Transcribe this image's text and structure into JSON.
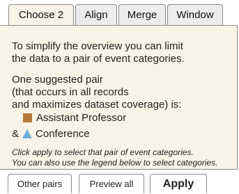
{
  "tabs": [
    {
      "label": "Choose 2",
      "active": true
    },
    {
      "label": "Align",
      "active": false
    },
    {
      "label": "Merge",
      "active": false
    },
    {
      "label": "Window",
      "active": false
    }
  ],
  "panel": {
    "intro_line1": "To simplify the overview you can limit",
    "intro_line2": "the data to a pair of event categories.",
    "suggest_line1": "One suggested pair",
    "suggest_line2": "(that occurs in all records",
    "suggest_line3": "and maximizes dataset coverage) is:",
    "pair": [
      {
        "label": "Assistant Professor",
        "icon": "square-icon",
        "color": "#b5793a",
        "prefix": ""
      },
      {
        "label": "Conference",
        "icon": "triangle-icon",
        "color": "#6aaee0",
        "prefix": "&"
      }
    ],
    "note_line1": "Click apply to select that pair of event categories.",
    "note_line2": "You can also use the legend below to select categories."
  },
  "buttons": {
    "other_pairs": "Other pairs",
    "preview_all": "Preview all",
    "apply": "Apply"
  },
  "colors": {
    "panel_bg": "#f7f3e6",
    "border": "#8a8a8a"
  }
}
